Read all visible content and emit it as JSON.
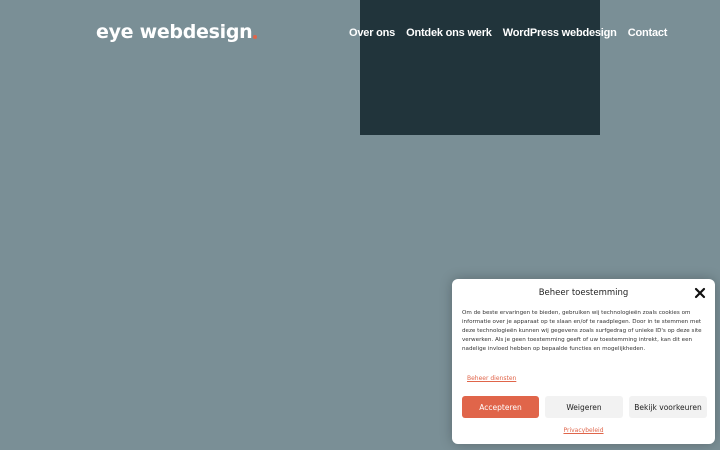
{
  "header": {
    "logo_text": "eye webdesign",
    "nav": [
      {
        "label": "Over ons"
      },
      {
        "label": "Ontdek ons werk"
      },
      {
        "label": "WordPress webdesign"
      },
      {
        "label": "Contact"
      }
    ]
  },
  "colors": {
    "page_background": "#7a8f96",
    "dark_block": "#21343b",
    "accent": "#e0654a"
  },
  "consent": {
    "title": "Beheer toestemming",
    "close_icon": "close-icon",
    "body": "Om de beste ervaringen te bieden, gebruiken wij technologieën zoals cookies om informatie over je apparaat op te slaan en/of te raadplegen. Door in te stemmen met deze technologieën kunnen wij gegevens zoals surfgedrag of unieke ID's op deze site verwerken. Als je geen toestemming geeft of uw toestemming intrekt, kan dit een nadelige invloed hebben op bepaalde functies en mogelijkheden.",
    "manage_link": "Beheer diensten",
    "accept_label": "Accepteren",
    "deny_label": "Weigeren",
    "preferences_label": "Bekijk voorkeuren",
    "privacy_link": "Privacybeleid"
  }
}
